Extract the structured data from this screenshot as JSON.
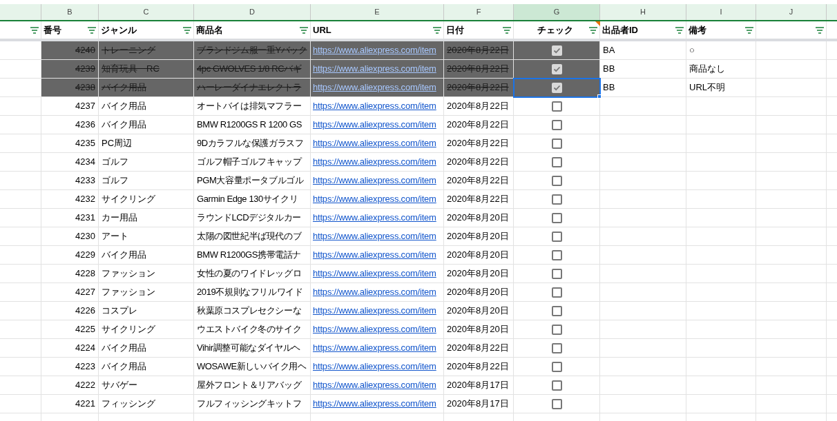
{
  "column_letters": [
    {
      "label": "B",
      "selected": false
    },
    {
      "label": "C",
      "selected": false
    },
    {
      "label": "D",
      "selected": false
    },
    {
      "label": "E",
      "selected": false
    },
    {
      "label": "F",
      "selected": false
    },
    {
      "label": "G",
      "selected": true
    },
    {
      "label": "H",
      "selected": false
    },
    {
      "label": "I",
      "selected": false
    },
    {
      "label": "J",
      "selected": false
    }
  ],
  "header_cells": [
    {
      "comment": false
    },
    {
      "label": "番号",
      "comment": false
    },
    {
      "label": "ジャンル",
      "comment": false
    },
    {
      "label": "商品名",
      "comment": false
    },
    {
      "label": "URL",
      "comment": false
    },
    {
      "label": "日付",
      "comment": false
    },
    {
      "label": "チェック",
      "comment": true
    },
    {
      "label": "出品者ID",
      "comment": false
    },
    {
      "label": "備考",
      "comment": false
    },
    {
      "comment": false
    }
  ],
  "rows": [
    {
      "number": "4240",
      "genre": "トレーニング",
      "product": "ブランドジム服一重Yバック",
      "url": "https://www.aliexpress.com/item",
      "date": "2020年8月22日",
      "checked": true,
      "selected": false,
      "seller_id": "BA",
      "note": "○"
    },
    {
      "number": "4239",
      "genre": "知育玩具　RC",
      "product": "4pc GWOLVES 1/8 RCバギ",
      "url": "https://www.aliexpress.com/item",
      "date": "2020年8月22日",
      "checked": true,
      "selected": false,
      "seller_id": "BB",
      "note": "商品なし"
    },
    {
      "number": "4238",
      "genre": "バイク用品",
      "product": "ハーレーダイナエレクトラ",
      "url": "https://www.aliexpress.com/item",
      "date": "2020年8月22日",
      "checked": true,
      "selected": true,
      "seller_id": "BB",
      "note": "URL不明"
    },
    {
      "number": "4237",
      "genre": "バイク用品",
      "product": "オートバイは排気マフラー",
      "url": "https://www.aliexpress.com/item",
      "date": "2020年8月22日",
      "checked": false,
      "selected": false
    },
    {
      "number": "4236",
      "genre": "バイク用品",
      "product": "BMW R1200GS R 1200 GS",
      "url": "https://www.aliexpress.com/item",
      "date": "2020年8月22日",
      "checked": false,
      "selected": false
    },
    {
      "number": "4235",
      "genre": "PC周辺",
      "product": "9Dカラフルな保護ガラスフ",
      "url": "https://www.aliexpress.com/item",
      "date": "2020年8月22日",
      "checked": false,
      "selected": false
    },
    {
      "number": "4234",
      "genre": "ゴルフ",
      "product": "ゴルフ帽子ゴルフキャップ",
      "url": "https://www.aliexpress.com/item",
      "date": "2020年8月22日",
      "checked": false,
      "selected": false
    },
    {
      "number": "4233",
      "genre": "ゴルフ",
      "product": "PGM大容量ポータブルゴル",
      "url": "https://www.aliexpress.com/item",
      "date": "2020年8月22日",
      "checked": false,
      "selected": false
    },
    {
      "number": "4232",
      "genre": "サイクリング",
      "product": "Garmin Edge 130サイクリ",
      "url": "https://www.aliexpress.com/item",
      "date": "2020年8月22日",
      "checked": false,
      "selected": false
    },
    {
      "number": "4231",
      "genre": "カー用品",
      "product": "ラウンドLCDデジタルカー",
      "url": "https://www.aliexpress.com/item",
      "date": "2020年8月20日",
      "checked": false,
      "selected": false
    },
    {
      "number": "4230",
      "genre": "アート",
      "product": "太陽の図世紀半ば現代のブ",
      "url": "https://www.aliexpress.com/item",
      "date": "2020年8月20日",
      "checked": false,
      "selected": false
    },
    {
      "number": "4229",
      "genre": "バイク用品",
      "product": "BMW R1200GS携帯電話ナ",
      "url": "https://www.aliexpress.com/item",
      "date": "2020年8月20日",
      "checked": false,
      "selected": false
    },
    {
      "number": "4228",
      "genre": "ファッション",
      "product": "女性の夏のワイドレッグロ",
      "url": "https://www.aliexpress.com/item",
      "date": "2020年8月20日",
      "checked": false,
      "selected": false
    },
    {
      "number": "4227",
      "genre": "ファッション",
      "product": "2019不規則なフリルワイド",
      "url": "https://www.aliexpress.com/item",
      "date": "2020年8月20日",
      "checked": false,
      "selected": false
    },
    {
      "number": "4226",
      "genre": "コスプレ",
      "product": "秋葉原コスプレセクシーな",
      "url": "https://www.aliexpress.com/item",
      "date": "2020年8月20日",
      "checked": false,
      "selected": false
    },
    {
      "number": "4225",
      "genre": "サイクリング",
      "product": "ウエストバイク冬のサイク",
      "url": "https://www.aliexpress.com/item",
      "date": "2020年8月20日",
      "checked": false,
      "selected": false
    },
    {
      "number": "4224",
      "genre": "バイク用品",
      "product": "Vihir調整可能なダイヤルヘ",
      "url": "https://www.aliexpress.com/item",
      "date": "2020年8月22日",
      "checked": false,
      "selected": false
    },
    {
      "number": "4223",
      "genre": "バイク用品",
      "product": "WOSAWE新しいバイク用ヘ",
      "url": "https://www.aliexpress.com/item",
      "date": "2020年8月22日",
      "checked": false,
      "selected": false
    },
    {
      "number": "4222",
      "genre": "サバゲー",
      "product": "屋外フロント＆リアバッグ",
      "url": "https://www.aliexpress.com/item",
      "date": "2020年8月17日",
      "checked": false,
      "selected": false
    },
    {
      "number": "4221",
      "genre": "フィッシング",
      "product": "フルフィッシングキットフ",
      "url": "https://www.aliexpress.com/item",
      "date": "2020年8月17日",
      "checked": false,
      "selected": false
    }
  ]
}
